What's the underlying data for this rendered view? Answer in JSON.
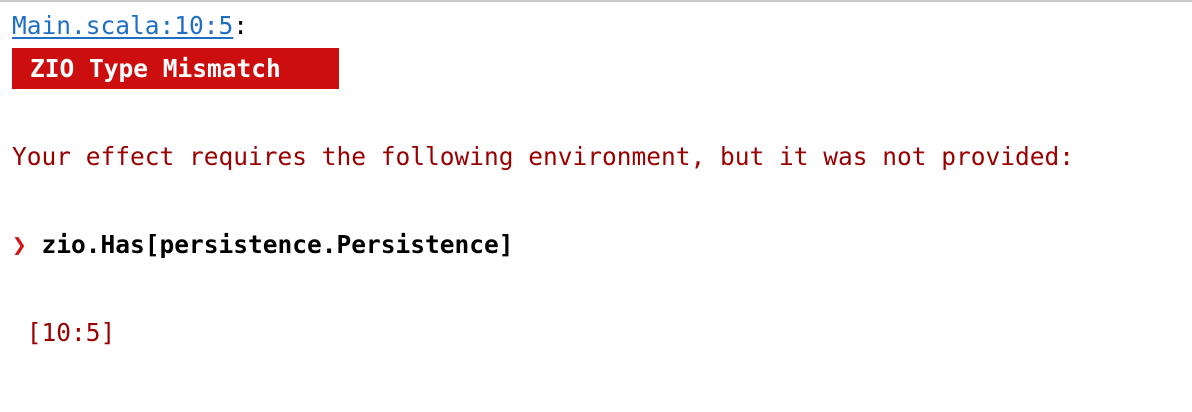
{
  "location": {
    "link_text": "Main.scala:10:5",
    "suffix": ":"
  },
  "badge": {
    "title": "ZIO Type Mismatch"
  },
  "message": {
    "text": "Your effect requires the following environment, but it was not provided:"
  },
  "requirement": {
    "marker": "❯",
    "type": "zio.Has[persistence.Persistence]"
  },
  "position": {
    "text": "[10:5]"
  },
  "colors": {
    "link": "#1f6fc5",
    "badge_bg": "#cc0e0e",
    "error_text": "#990000",
    "marker": "#d01717"
  }
}
